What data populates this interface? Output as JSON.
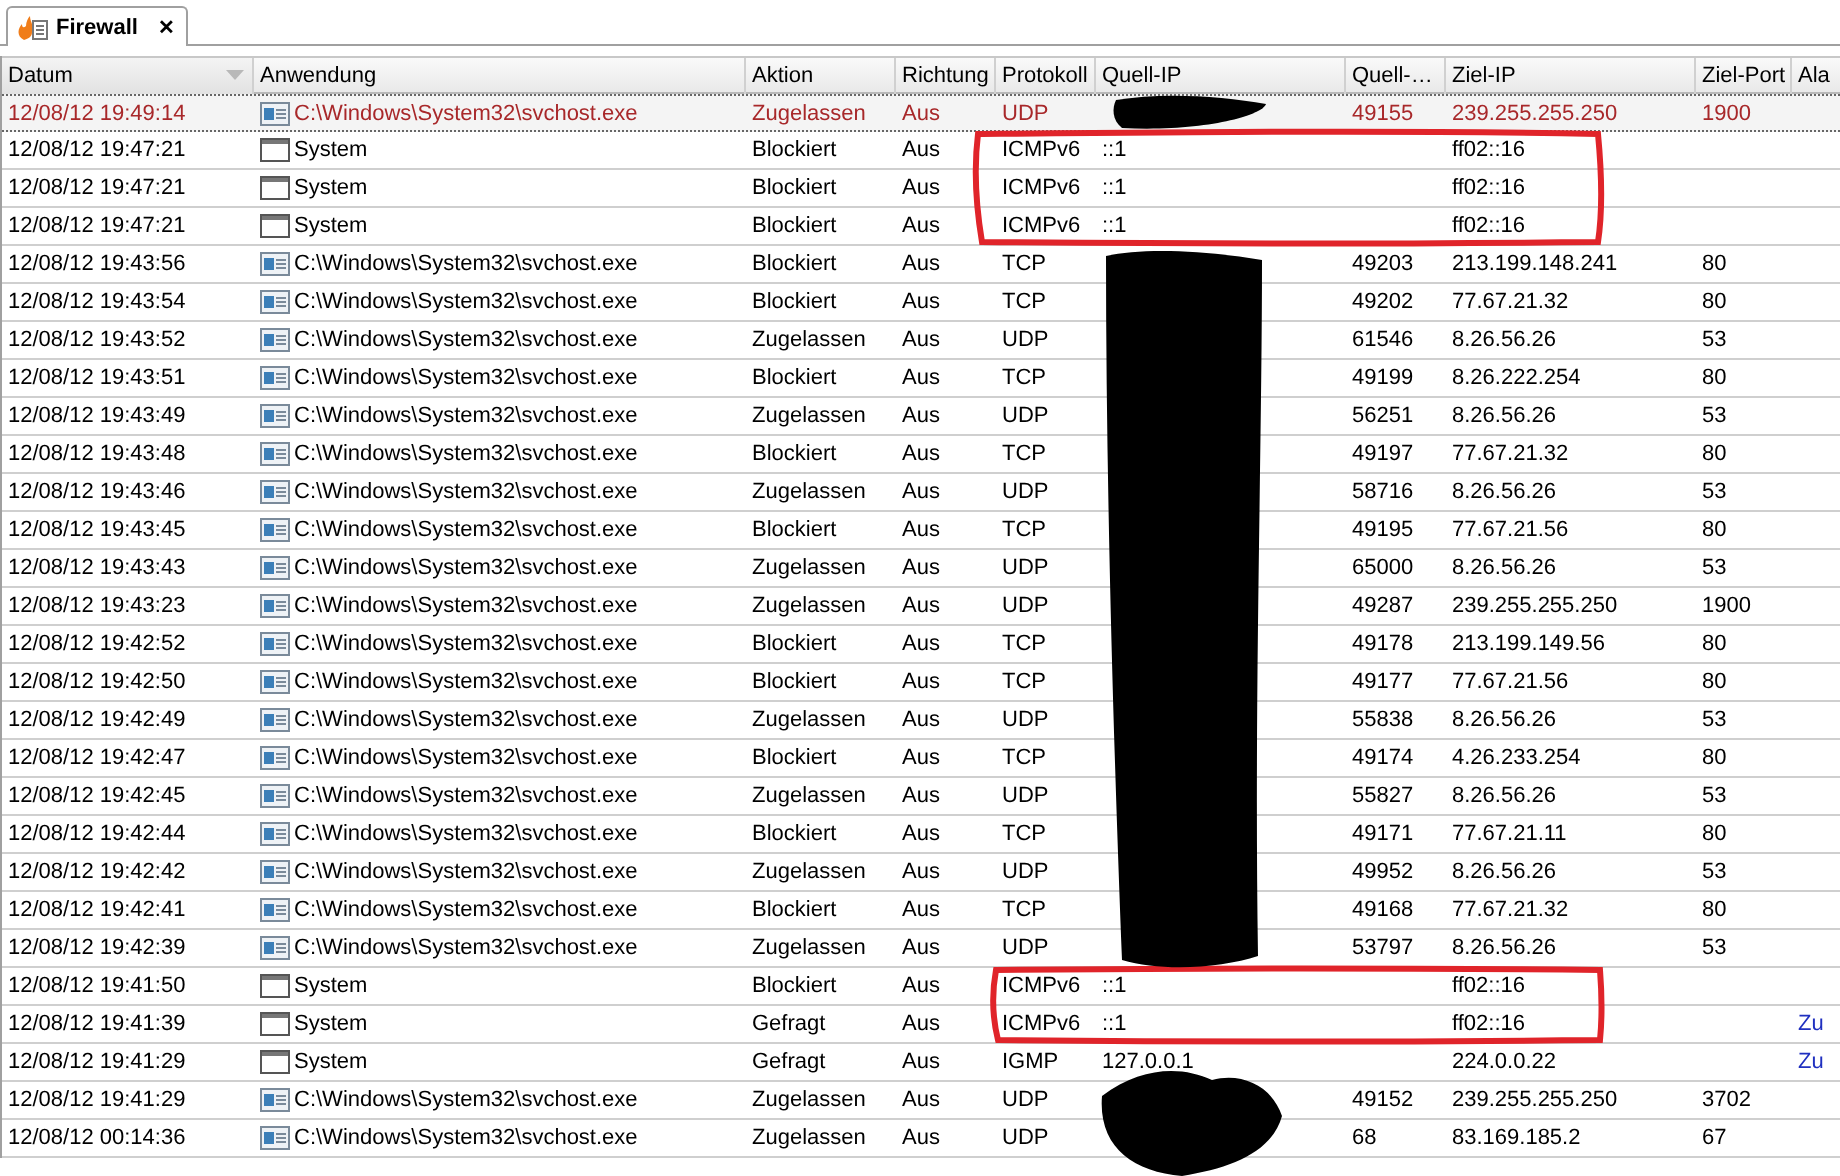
{
  "tab": {
    "title": "Firewall",
    "close": "✕",
    "selected": true
  },
  "table": {
    "columns": [
      {
        "label": "Datum",
        "sorted": true
      },
      {
        "label": "Anwendung",
        "sorted": false
      },
      {
        "label": "Aktion",
        "sorted": false
      },
      {
        "label": "Richtung",
        "sorted": false
      },
      {
        "label": "Protokoll",
        "sorted": false
      },
      {
        "label": "Quell-IP",
        "sorted": false
      },
      {
        "label": "Quell-…",
        "sorted": false
      },
      {
        "label": "Ziel-IP",
        "sorted": false
      },
      {
        "label": "Ziel-Port",
        "sorted": false
      },
      {
        "label": "Ala",
        "sorted": false
      }
    ],
    "rows": [
      {
        "selected": true,
        "kind": "service",
        "datum": "12/08/12 19:49:14",
        "anwendung": "C:\\Windows\\System32\\svchost.exe",
        "aktion": "Zugelassen",
        "richtung": "Aus",
        "protokoll": "UDP",
        "quell_port": "49155",
        "ziel_ip": "239.255.255.250",
        "ziel_port": "1900"
      },
      {
        "selected": false,
        "kind": "system",
        "datum": "12/08/12 19:47:21",
        "anwendung": "System",
        "aktion": "Blockiert",
        "richtung": "Aus",
        "protokoll": "ICMPv6",
        "quell_ip": "::1",
        "ziel_ip": "ff02::16"
      },
      {
        "selected": false,
        "kind": "system",
        "datum": "12/08/12 19:47:21",
        "anwendung": "System",
        "aktion": "Blockiert",
        "richtung": "Aus",
        "protokoll": "ICMPv6",
        "quell_ip": "::1",
        "ziel_ip": "ff02::16"
      },
      {
        "selected": false,
        "kind": "system",
        "datum": "12/08/12 19:47:21",
        "anwendung": "System",
        "aktion": "Blockiert",
        "richtung": "Aus",
        "protokoll": "ICMPv6",
        "quell_ip": "::1",
        "ziel_ip": "ff02::16"
      },
      {
        "selected": false,
        "kind": "service",
        "datum": "12/08/12 19:43:56",
        "anwendung": "C:\\Windows\\System32\\svchost.exe",
        "aktion": "Blockiert",
        "richtung": "Aus",
        "protokoll": "TCP",
        "quell_port": "49203",
        "ziel_ip": "213.199.148.241",
        "ziel_port": "80"
      },
      {
        "selected": false,
        "kind": "service",
        "datum": "12/08/12 19:43:54",
        "anwendung": "C:\\Windows\\System32\\svchost.exe",
        "aktion": "Blockiert",
        "richtung": "Aus",
        "protokoll": "TCP",
        "quell_port": "49202",
        "ziel_ip": "77.67.21.32",
        "ziel_port": "80"
      },
      {
        "selected": false,
        "kind": "service",
        "datum": "12/08/12 19:43:52",
        "anwendung": "C:\\Windows\\System32\\svchost.exe",
        "aktion": "Zugelassen",
        "richtung": "Aus",
        "protokoll": "UDP",
        "quell_port": "61546",
        "ziel_ip": "8.26.56.26",
        "ziel_port": "53"
      },
      {
        "selected": false,
        "kind": "service",
        "datum": "12/08/12 19:43:51",
        "anwendung": "C:\\Windows\\System32\\svchost.exe",
        "aktion": "Blockiert",
        "richtung": "Aus",
        "protokoll": "TCP",
        "quell_port": "49199",
        "ziel_ip": "8.26.222.254",
        "ziel_port": "80"
      },
      {
        "selected": false,
        "kind": "service",
        "datum": "12/08/12 19:43:49",
        "anwendung": "C:\\Windows\\System32\\svchost.exe",
        "aktion": "Zugelassen",
        "richtung": "Aus",
        "protokoll": "UDP",
        "quell_port": "56251",
        "ziel_ip": "8.26.56.26",
        "ziel_port": "53"
      },
      {
        "selected": false,
        "kind": "service",
        "datum": "12/08/12 19:43:48",
        "anwendung": "C:\\Windows\\System32\\svchost.exe",
        "aktion": "Blockiert",
        "richtung": "Aus",
        "protokoll": "TCP",
        "quell_port": "49197",
        "ziel_ip": "77.67.21.32",
        "ziel_port": "80"
      },
      {
        "selected": false,
        "kind": "service",
        "datum": "12/08/12 19:43:46",
        "anwendung": "C:\\Windows\\System32\\svchost.exe",
        "aktion": "Zugelassen",
        "richtung": "Aus",
        "protokoll": "UDP",
        "quell_port": "58716",
        "ziel_ip": "8.26.56.26",
        "ziel_port": "53"
      },
      {
        "selected": false,
        "kind": "service",
        "datum": "12/08/12 19:43:45",
        "anwendung": "C:\\Windows\\System32\\svchost.exe",
        "aktion": "Blockiert",
        "richtung": "Aus",
        "protokoll": "TCP",
        "quell_port": "49195",
        "ziel_ip": "77.67.21.56",
        "ziel_port": "80"
      },
      {
        "selected": false,
        "kind": "service",
        "datum": "12/08/12 19:43:43",
        "anwendung": "C:\\Windows\\System32\\svchost.exe",
        "aktion": "Zugelassen",
        "richtung": "Aus",
        "protokoll": "UDP",
        "quell_port": "65000",
        "ziel_ip": "8.26.56.26",
        "ziel_port": "53"
      },
      {
        "selected": false,
        "kind": "service",
        "datum": "12/08/12 19:43:23",
        "anwendung": "C:\\Windows\\System32\\svchost.exe",
        "aktion": "Zugelassen",
        "richtung": "Aus",
        "protokoll": "UDP",
        "quell_port": "49287",
        "ziel_ip": "239.255.255.250",
        "ziel_port": "1900"
      },
      {
        "selected": false,
        "kind": "service",
        "datum": "12/08/12 19:42:52",
        "anwendung": "C:\\Windows\\System32\\svchost.exe",
        "aktion": "Blockiert",
        "richtung": "Aus",
        "protokoll": "TCP",
        "quell_port": "49178",
        "ziel_ip": "213.199.149.56",
        "ziel_port": "80"
      },
      {
        "selected": false,
        "kind": "service",
        "datum": "12/08/12 19:42:50",
        "anwendung": "C:\\Windows\\System32\\svchost.exe",
        "aktion": "Blockiert",
        "richtung": "Aus",
        "protokoll": "TCP",
        "quell_port": "49177",
        "ziel_ip": "77.67.21.56",
        "ziel_port": "80"
      },
      {
        "selected": false,
        "kind": "service",
        "datum": "12/08/12 19:42:49",
        "anwendung": "C:\\Windows\\System32\\svchost.exe",
        "aktion": "Zugelassen",
        "richtung": "Aus",
        "protokoll": "UDP",
        "quell_port": "55838",
        "ziel_ip": "8.26.56.26",
        "ziel_port": "53"
      },
      {
        "selected": false,
        "kind": "service",
        "datum": "12/08/12 19:42:47",
        "anwendung": "C:\\Windows\\System32\\svchost.exe",
        "aktion": "Blockiert",
        "richtung": "Aus",
        "protokoll": "TCP",
        "quell_port": "49174",
        "ziel_ip": "4.26.233.254",
        "ziel_port": "80"
      },
      {
        "selected": false,
        "kind": "service",
        "datum": "12/08/12 19:42:45",
        "anwendung": "C:\\Windows\\System32\\svchost.exe",
        "aktion": "Zugelassen",
        "richtung": "Aus",
        "protokoll": "UDP",
        "quell_port": "55827",
        "ziel_ip": "8.26.56.26",
        "ziel_port": "53"
      },
      {
        "selected": false,
        "kind": "service",
        "datum": "12/08/12 19:42:44",
        "anwendung": "C:\\Windows\\System32\\svchost.exe",
        "aktion": "Blockiert",
        "richtung": "Aus",
        "protokoll": "TCP",
        "quell_port": "49171",
        "ziel_ip": "77.67.21.11",
        "ziel_port": "80"
      },
      {
        "selected": false,
        "kind": "service",
        "datum": "12/08/12 19:42:42",
        "anwendung": "C:\\Windows\\System32\\svchost.exe",
        "aktion": "Zugelassen",
        "richtung": "Aus",
        "protokoll": "UDP",
        "quell_port": "49952",
        "ziel_ip": "8.26.56.26",
        "ziel_port": "53"
      },
      {
        "selected": false,
        "kind": "service",
        "datum": "12/08/12 19:42:41",
        "anwendung": "C:\\Windows\\System32\\svchost.exe",
        "aktion": "Blockiert",
        "richtung": "Aus",
        "protokoll": "TCP",
        "quell_port": "49168",
        "ziel_ip": "77.67.21.32",
        "ziel_port": "80"
      },
      {
        "selected": false,
        "kind": "service",
        "datum": "12/08/12 19:42:39",
        "anwendung": "C:\\Windows\\System32\\svchost.exe",
        "aktion": "Zugelassen",
        "richtung": "Aus",
        "protokoll": "UDP",
        "quell_port": "53797",
        "ziel_ip": "8.26.56.26",
        "ziel_port": "53"
      },
      {
        "selected": false,
        "kind": "system",
        "datum": "12/08/12 19:41:50",
        "anwendung": "System",
        "aktion": "Blockiert",
        "richtung": "Aus",
        "protokoll": "ICMPv6",
        "quell_ip": "::1",
        "ziel_ip": "ff02::16"
      },
      {
        "selected": false,
        "kind": "system",
        "datum": "12/08/12 19:41:39",
        "anwendung": "System",
        "aktion": "Gefragt",
        "richtung": "Aus",
        "protokoll": "ICMPv6",
        "quell_ip": "::1",
        "ziel_ip": "ff02::16",
        "column_10": "Zu"
      },
      {
        "selected": false,
        "kind": "system",
        "datum": "12/08/12 19:41:29",
        "anwendung": "System",
        "aktion": "Gefragt",
        "richtung": "Aus",
        "protokoll": "IGMP",
        "quell_ip": "127.0.0.1",
        "ziel_ip": "224.0.0.22",
        "column_10": "Zu"
      },
      {
        "selected": false,
        "kind": "service",
        "datum": "12/08/12 19:41:29",
        "anwendung": "C:\\Windows\\System32\\svchost.exe",
        "aktion": "Zugelassen",
        "richtung": "Aus",
        "protokoll": "UDP",
        "quell_port": "49152",
        "ziel_ip": "239.255.255.250",
        "ziel_port": "3702"
      },
      {
        "selected": false,
        "kind": "service",
        "datum": "12/08/12 00:14:36",
        "anwendung": "C:\\Windows\\System32\\svchost.exe",
        "aktion": "Zugelassen",
        "richtung": "Aus",
        "protokoll": "UDP",
        "quell_port": "68",
        "ziel_ip": "83.169.185.2",
        "ziel_port": "67"
      }
    ]
  }
}
